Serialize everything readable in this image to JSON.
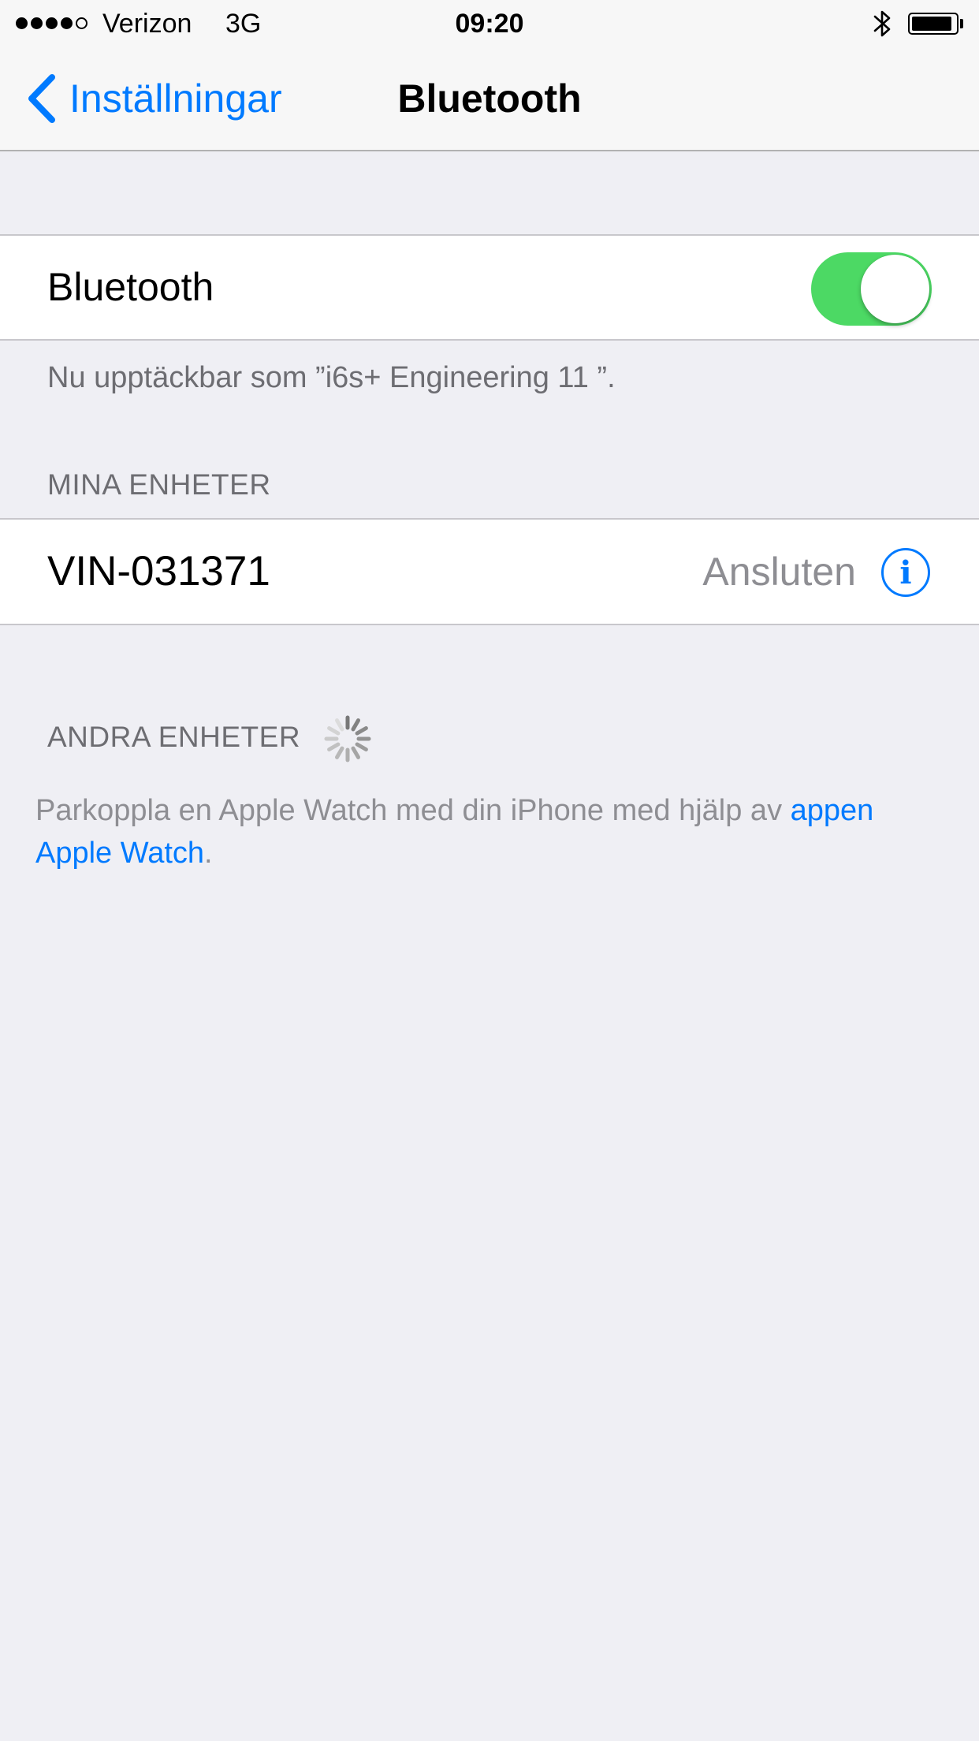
{
  "status_bar": {
    "carrier": "Verizon",
    "network": "3G",
    "time": "09:20",
    "signal_bars": 4,
    "signal_bars_total": 5,
    "battery_level": 0.9,
    "icons": [
      "signal-dots-icon",
      "bluetooth-icon",
      "battery-icon"
    ]
  },
  "nav": {
    "back_label": "Inställningar",
    "title": "Bluetooth"
  },
  "bluetooth_cell": {
    "label": "Bluetooth",
    "enabled": true
  },
  "discoverable_text": "Nu upptäckbar som ”i6s+ Engineering 11 ”.",
  "my_devices": {
    "header": "MINA ENHETER",
    "items": [
      {
        "name": "VIN-031371",
        "status": "Ansluten"
      }
    ]
  },
  "other_devices": {
    "header": "ANDRA ENHETER",
    "pair_prefix": "Parkoppla en Apple Watch med din iPhone med hjälp av ",
    "pair_link": "appen Apple Watch",
    "pair_suffix": "."
  },
  "colors": {
    "accent": "#007aff",
    "toggle_on": "#4cd964",
    "background": "#efeff4",
    "secondary_text": "#6d6d72"
  }
}
